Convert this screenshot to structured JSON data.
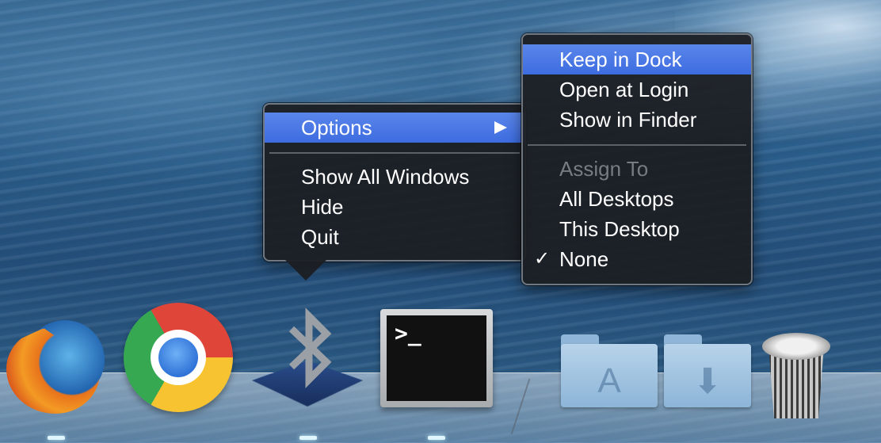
{
  "context_menu": {
    "items": [
      {
        "label": "Options",
        "selected": true
      },
      {
        "label": "Show All Windows"
      },
      {
        "label": "Hide"
      },
      {
        "label": "Quit"
      }
    ]
  },
  "options_submenu": {
    "items": [
      {
        "label": "Keep in Dock",
        "selected": true
      },
      {
        "label": "Open at Login"
      },
      {
        "label": "Show in Finder"
      }
    ],
    "section_header": "Assign To",
    "assign_items": [
      {
        "label": "All Desktops"
      },
      {
        "label": "This Desktop"
      },
      {
        "label": "None",
        "checked": true
      }
    ]
  },
  "dock": {
    "items": [
      {
        "name": "Firefox",
        "icon": "firefox-icon",
        "running": true
      },
      {
        "name": "Google Chrome",
        "icon": "chrome-icon",
        "running": false
      },
      {
        "name": "Bluetooth File Exchange",
        "icon": "bluetooth-icon",
        "running": true
      },
      {
        "name": "Terminal",
        "icon": "terminal-icon",
        "running": true
      },
      {
        "name": "Applications",
        "icon": "applications-folder-icon"
      },
      {
        "name": "Downloads",
        "icon": "downloads-folder-icon"
      },
      {
        "name": "Trash",
        "icon": "trash-icon"
      }
    ],
    "terminal_prompt": ">_"
  },
  "colors": {
    "selection": "#3d6ce0",
    "menu_bg": "#1c1e22"
  }
}
